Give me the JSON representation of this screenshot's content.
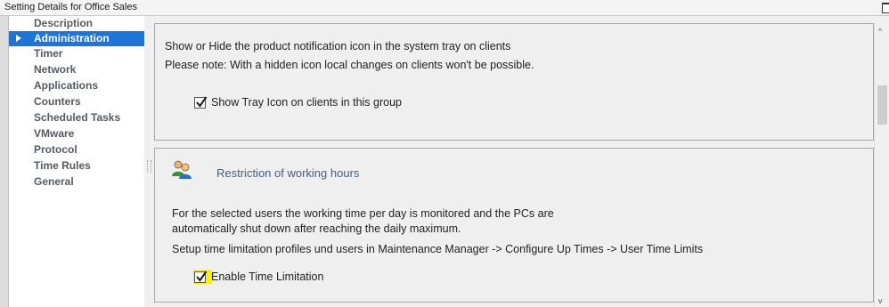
{
  "window": {
    "title": "Setting Details for Office Sales"
  },
  "sidebar": {
    "items": [
      {
        "label": "Description"
      },
      {
        "label": "Administration",
        "selected": true
      },
      {
        "label": "Timer"
      },
      {
        "label": "Network"
      },
      {
        "label": "Applications"
      },
      {
        "label": "Counters"
      },
      {
        "label": "Scheduled Tasks"
      },
      {
        "label": "VMware"
      },
      {
        "label": "Protocol"
      },
      {
        "label": "Time Rules"
      },
      {
        "label": "General"
      }
    ]
  },
  "tray_panel": {
    "line1": "Show or Hide the product notification icon in the system tray on clients",
    "line2": "Please note: With a hidden icon local changes on clients won't be possible.",
    "checkbox_label": "Show Tray Icon on clients in this group",
    "checked": true
  },
  "restriction_panel": {
    "heading": "Restriction of working hours",
    "icon": "users-icon",
    "desc_line1": "For the selected users the working time per day is monitored and the PCs are",
    "desc_line2": "automatically shut down after reaching the daily maximum.",
    "setup_text": "Setup time limitation profiles und users in Maintenance Manager -> Configure Up Times -> User Time Limits",
    "checkbox_label": "Enable Time Limitation",
    "checked": true
  },
  "colors": {
    "selection": "#1f74d7",
    "highlight": "#fff200",
    "heading": "#4a5e7a"
  }
}
